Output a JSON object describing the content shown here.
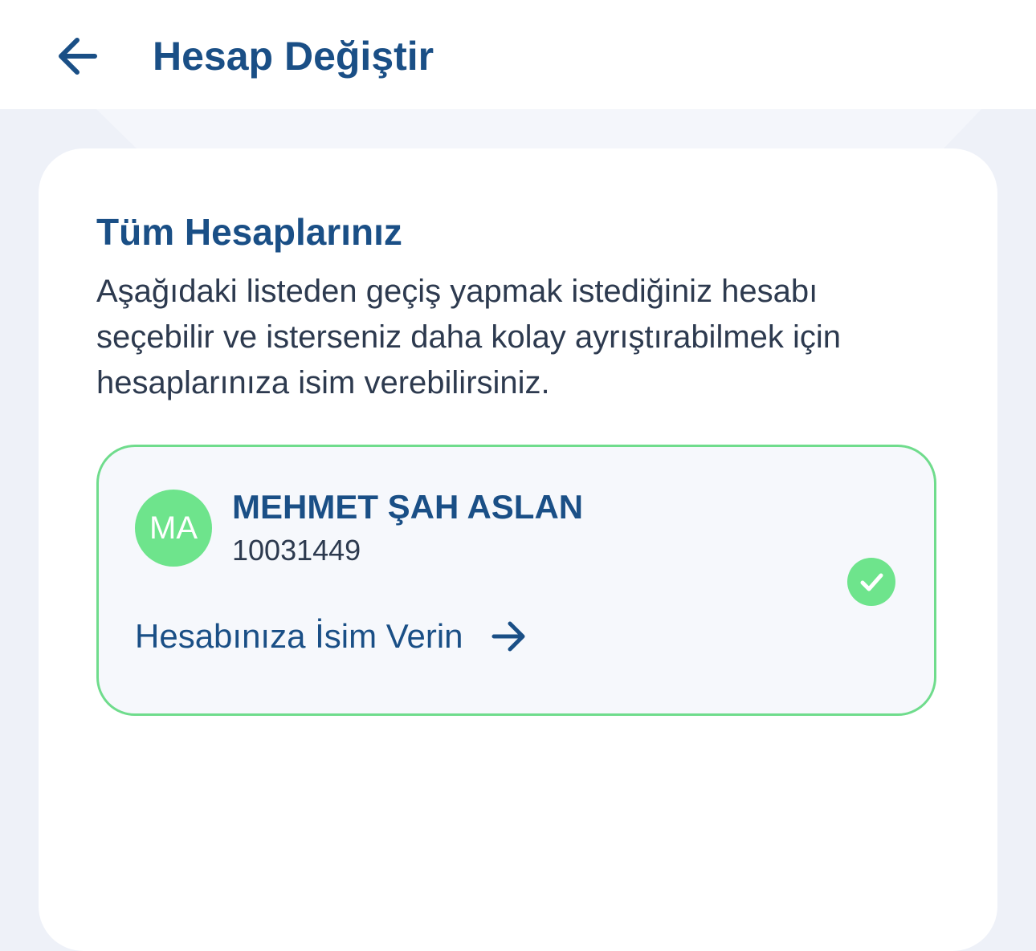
{
  "header": {
    "title": "Hesap Değiştir",
    "back_icon": "arrow-left-icon"
  },
  "accounts_section": {
    "title": "Tüm Hesaplarınız",
    "description": "Aşağıdaki listeden geçiş yapmak istediğiniz hesabı seçebilir ve isterseniz daha kolay ayrıştırabilmek için hesaplarınıza isim verebilirsiniz."
  },
  "accounts": [
    {
      "initials": "MA",
      "name": "MEHMET ŞAH ASLAN",
      "number": "10031449",
      "selected": true,
      "rename_label": "Hesabınıza İsim Verin",
      "rename_icon": "arrow-right-icon",
      "check_icon": "check-circle-icon"
    }
  ],
  "colors": {
    "primary": "#1a4f86",
    "text": "#2d3a4f",
    "accent_green": "#6ee48c",
    "card_border": "#6fdc8c",
    "page_background": "#eef1f8",
    "card_background": "#f6f8fc"
  }
}
